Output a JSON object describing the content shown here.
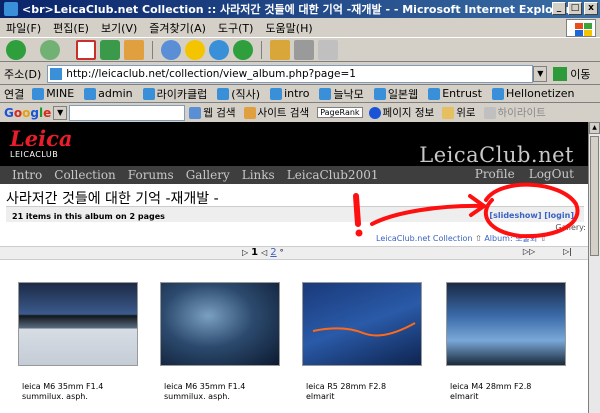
{
  "window": {
    "title": "<br>LeicaClub.net Collection :: 사라저간 것들에 대한 기억 -재개발 - - Microsoft Internet Explorer",
    "controls": [
      "_",
      "□",
      "x"
    ]
  },
  "menu": [
    "파일(F)",
    "편집(E)",
    "보기(V)",
    "즐겨찾기(A)",
    "도구(T)",
    "도움말(H)"
  ],
  "address": {
    "label": "주소(D)",
    "url": "http://leicaclub.net/collection/view_album.php?page=1",
    "go_label": "이동"
  },
  "links": {
    "label": "연결",
    "items": [
      "MINE",
      "admin",
      "라이카클럽",
      "(직사)",
      "intro",
      "늘낙모",
      "일본웹",
      "Entrust",
      "Hellonetizen"
    ]
  },
  "googlebar": {
    "logo": "Google",
    "items": [
      "웹 검색",
      "사이트 검색",
      "PageRank",
      "페이지 정보",
      "위로",
      "하이라이트"
    ]
  },
  "site": {
    "logo_script": "Leica",
    "logo_sub": "LEICACLUB",
    "title": "LeicaClub.net",
    "nav_left": [
      "Intro",
      "Collection",
      "Forums",
      "Gallery",
      "Links",
      "LeicaClub2001"
    ],
    "nav_right": [
      "Profile",
      "LogOut"
    ]
  },
  "album": {
    "title": "사라저간 것들에 대한 기억 -재개발 -",
    "count_text": "21 items in this album on 2 pages",
    "actions": [
      "[slideshow]",
      "[login]"
    ],
    "gallery_label": "Gallery:",
    "breadcrumb": [
      "LeicaClub.net Collection",
      "Album: 뽀술회"
    ],
    "pages": [
      "1",
      "2"
    ]
  },
  "thumbnails": [
    {
      "caption_line1": "leica M6 35mm F1.4",
      "caption_line2": "summilux. asph."
    },
    {
      "caption_line1": "leica M6 35mm F1.4",
      "caption_line2": "summilux. asph."
    },
    {
      "caption_line1": "leica R5 28mm F2.8",
      "caption_line2": "elmarit"
    },
    {
      "caption_line1": "leica M4 28mm F2.8",
      "caption_line2": "elmarit"
    }
  ],
  "colors": {
    "titlebar": "#0a246a",
    "leica_red": "#e81e2a",
    "link_blue": "#3a63c4",
    "annotation_red": "#ff0000"
  }
}
